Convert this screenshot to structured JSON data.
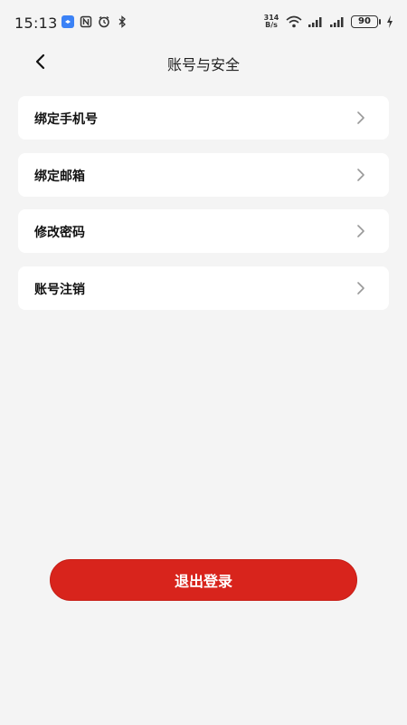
{
  "status_bar": {
    "time": "15:13",
    "net_speed_value": "314",
    "net_speed_unit": "B/s",
    "battery": "90"
  },
  "header": {
    "title": "账号与安全"
  },
  "menu": {
    "items": [
      {
        "label": "绑定手机号"
      },
      {
        "label": "绑定邮箱"
      },
      {
        "label": "修改密码"
      },
      {
        "label": "账号注销"
      }
    ]
  },
  "logout": {
    "label": "退出登录",
    "color": "#d8241c"
  },
  "icons": {
    "back": "back-arrow-icon",
    "chevron": "chevron-right-icon"
  }
}
